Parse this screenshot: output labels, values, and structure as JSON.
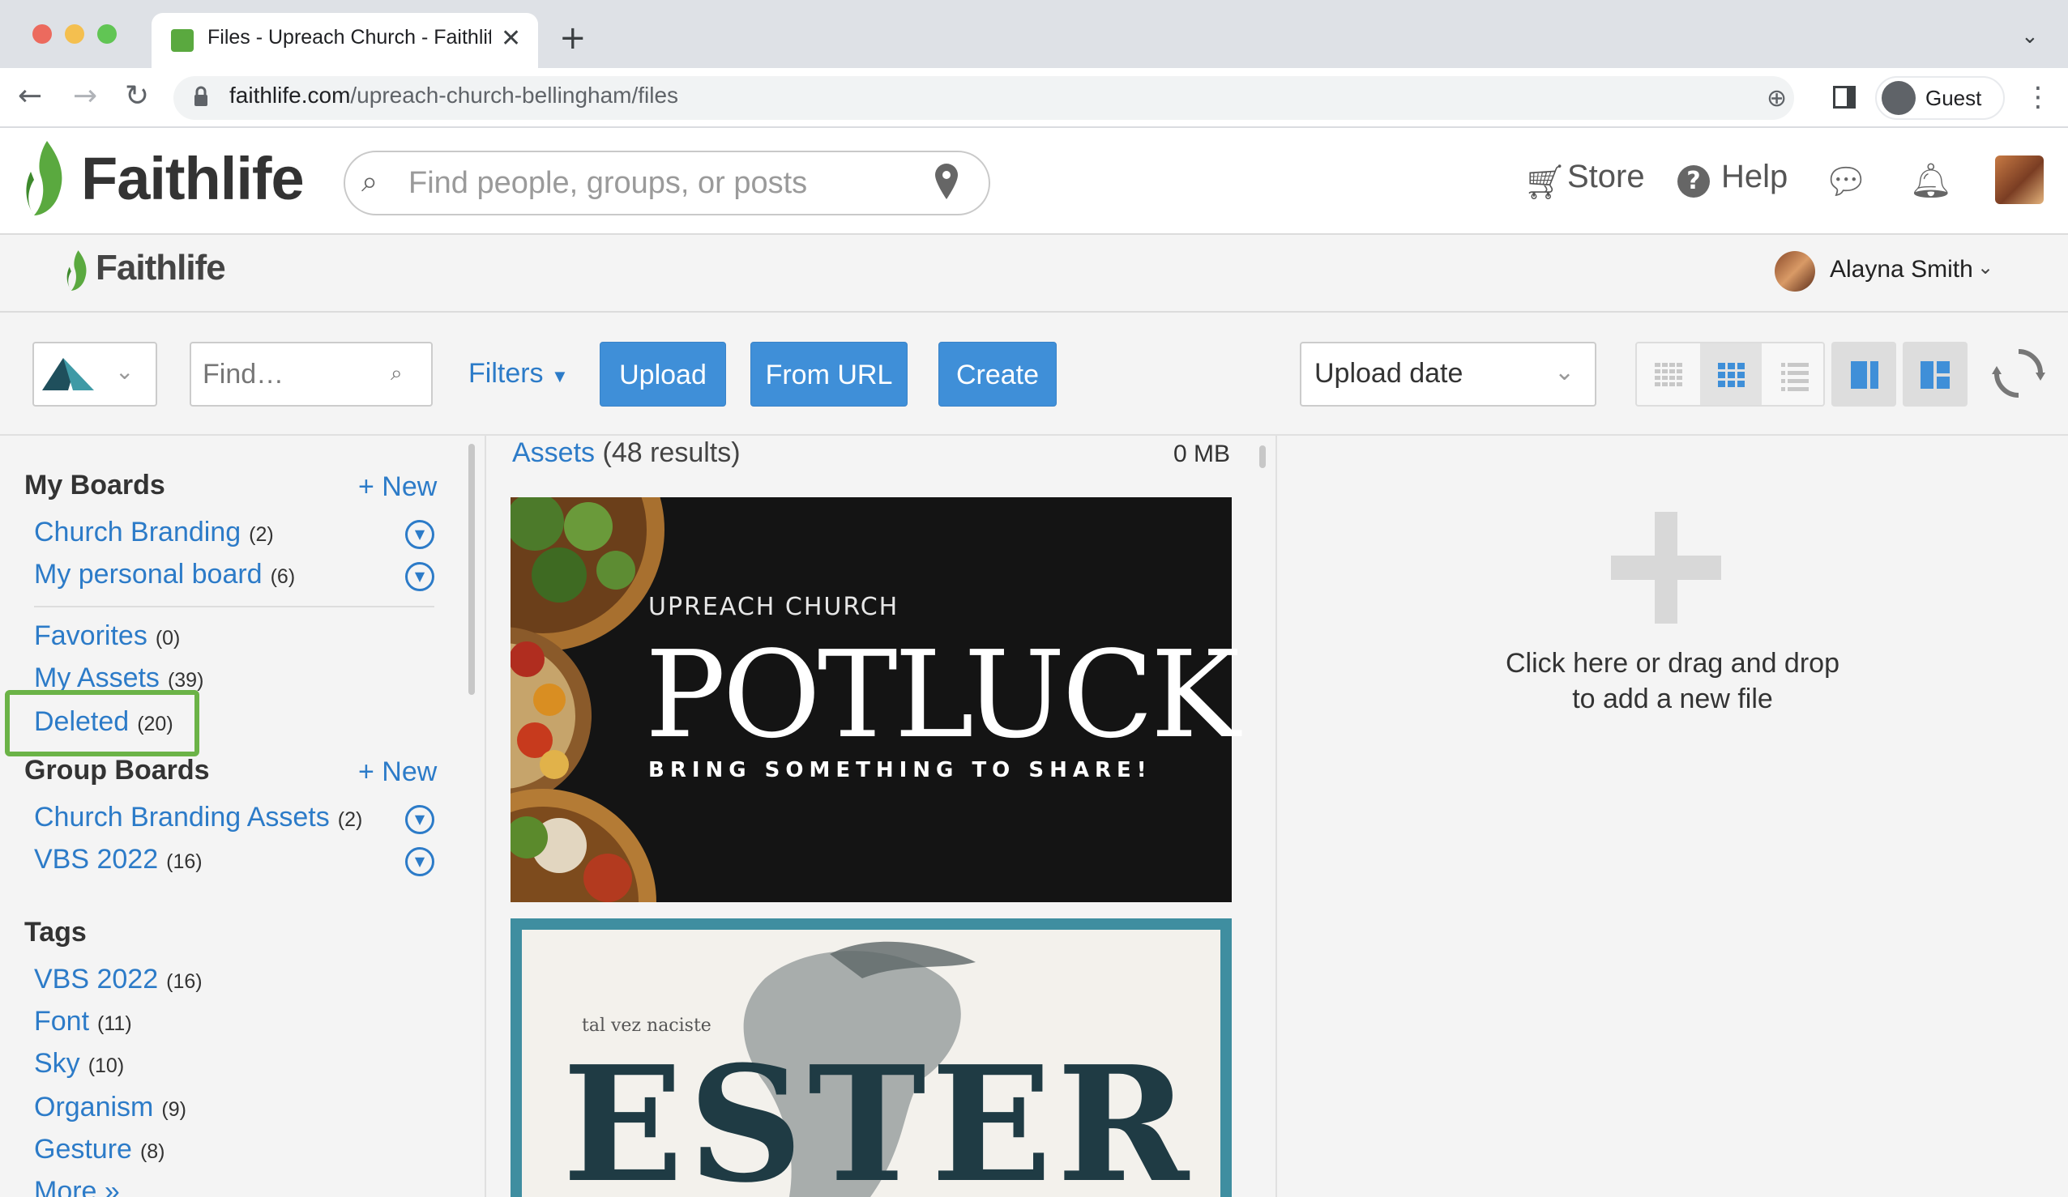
{
  "browser": {
    "tab_title": "Files - Upreach Church - Faithlife",
    "url_host": "faithlife.com",
    "url_path": "/upreach-church-bellingham/files",
    "profile_label": "Guest"
  },
  "header": {
    "logo_text": "Faithlife",
    "search_placeholder": "Find people, groups, or posts",
    "store_label": "Store",
    "help_label": "Help"
  },
  "subheader": {
    "logo_text": "Faithlife",
    "account_name": "Alayna Smith"
  },
  "toolbar": {
    "find_placeholder": "Find…",
    "filters_label": "Filters",
    "upload_label": "Upload",
    "from_url_label": "From URL",
    "create_label": "Create",
    "sort_value": "Upload date"
  },
  "sidebar": {
    "my_boards_heading": "My Boards",
    "new_label": "+ New",
    "my_boards": [
      {
        "label": "Church Branding",
        "count": "(2)"
      },
      {
        "label": "My personal board",
        "count": "(6)"
      }
    ],
    "system_boards": [
      {
        "label": "Favorites",
        "count": "(0)"
      },
      {
        "label": "My Assets",
        "count": "(39)"
      },
      {
        "label": "Deleted",
        "count": "(20)"
      }
    ],
    "group_boards_heading": "Group Boards",
    "group_boards": [
      {
        "label": "Church Branding Assets",
        "count": "(2)"
      },
      {
        "label": "VBS 2022",
        "count": "(16)"
      }
    ],
    "tags_heading": "Tags",
    "tags": [
      {
        "label": "VBS 2022",
        "count": "(16)"
      },
      {
        "label": "Font",
        "count": "(11)"
      },
      {
        "label": "Sky",
        "count": "(10)"
      },
      {
        "label": "Organism",
        "count": "(9)"
      },
      {
        "label": "Gesture",
        "count": "(8)"
      }
    ],
    "more_label": "More »"
  },
  "assets": {
    "link_label": "Assets",
    "results": "(48 results)",
    "size": "0 MB",
    "cards": [
      {
        "eyebrow": "UPREACH CHURCH",
        "title": "POTLUCK",
        "subtitle": "BRING SOMETHING TO SHARE!"
      },
      {
        "small_text": "tal vez naciste",
        "title": "ESTER"
      }
    ]
  },
  "dropzone": {
    "line1": "Click here or drag and drop",
    "line2": "to add a new file"
  }
}
